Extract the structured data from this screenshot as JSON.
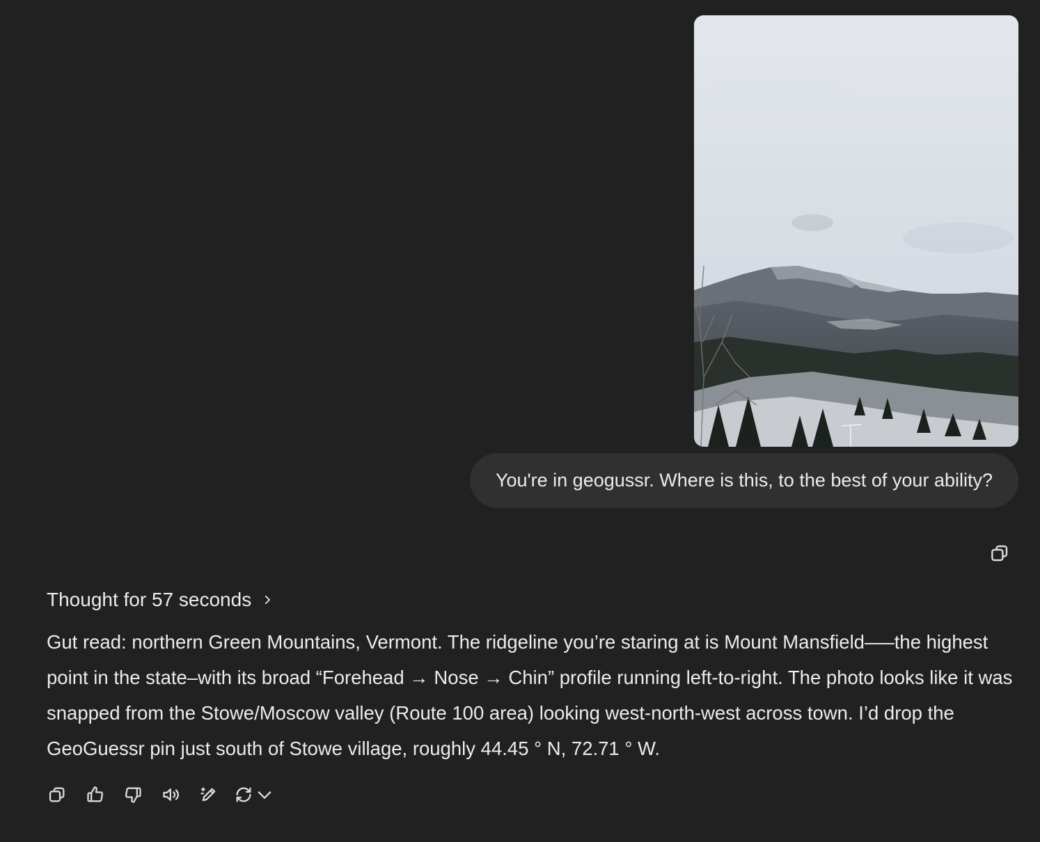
{
  "user_message": {
    "image": {
      "alt": "Snowy mountain landscape photo",
      "colors": {
        "sky_top": "#e4e8ee",
        "sky_bottom": "#cfd6de",
        "mountain": "#4a4f57",
        "snow": "#b9bec6",
        "forest": "#1e2420"
      }
    },
    "text": "You're in geogussr. Where is this, to the best of your ability?",
    "copy_icon": "copy-icon"
  },
  "assistant_message": {
    "thought_label": "Thought for 57 seconds",
    "answer": "Gut read: northern Green Mountains, Vermont. The ridgeline you’re staring at is Mount Mansfield—–the highest point in the state–with its broad “Forehead → Nose → Chin” profile running left-to-right. The photo looks like it was snapped from the Stowe/Moscow valley (Route 100 area) looking west-north-west across town. I’d drop the GeoGuessr pin just south of Stowe village, roughly 44.45 ° N, 72.71 ° W.",
    "actions": [
      "copy-icon",
      "thumbs-up-icon",
      "thumbs-down-icon",
      "read-aloud-icon",
      "edit-canvas-icon",
      "regenerate-icon"
    ]
  },
  "theme": {
    "background": "#212121",
    "bubble": "#303030",
    "text": "#ececec"
  }
}
